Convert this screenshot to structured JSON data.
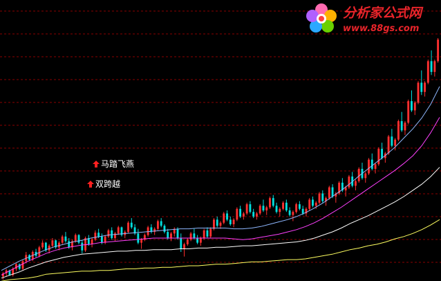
{
  "watermark": {
    "title": "分析家公式网",
    "url": "www.88gs.com"
  },
  "signals": [
    {
      "label": "马踏飞燕",
      "marker": "up-arrow-icon"
    },
    {
      "label": "双跨越",
      "marker": "up-arrow-icon"
    }
  ],
  "colors": {
    "background": "#000000",
    "grid": "#8b0000",
    "up_candle": "#ff3030",
    "down_candle": "#00e0e0",
    "ma_fast": "#ffff60",
    "ma_mid": "#ffffff",
    "ma_slow": "#ff40ff",
    "ma_long": "#8fb8ff",
    "signal_arrow": "#ff2020"
  },
  "chart_data": {
    "type": "candlestick",
    "grid": true,
    "series": [
      {
        "values": [
          2,
          4,
          5,
          6,
          8,
          11,
          12,
          13,
          14,
          15,
          15,
          16,
          16,
          17,
          18,
          18,
          19,
          19,
          20,
          20,
          21,
          22,
          22,
          23,
          24,
          24,
          25,
          26,
          27,
          27,
          28,
          29,
          30,
          30,
          31,
          33,
          35,
          37,
          40,
          43,
          45,
          48,
          50,
          53,
          57,
          60,
          64,
          69,
          75,
          82
        ]
      },
      {
        "values": [
          6,
          10,
          14,
          19,
          23,
          27,
          30,
          33,
          35,
          37,
          38,
          39,
          40,
          41,
          41,
          42,
          42,
          43,
          43,
          43,
          44,
          44,
          45,
          45,
          46,
          46,
          47,
          48,
          48,
          49,
          50,
          51,
          52,
          53,
          55,
          58,
          62,
          66,
          71,
          77,
          82,
          87,
          93,
          99,
          105,
          112,
          120,
          128,
          138,
          150
        ]
      },
      {
        "values": [
          10,
          16,
          22,
          28,
          33,
          38,
          42,
          45,
          47,
          49,
          50,
          52,
          53,
          54,
          55,
          56,
          57,
          58,
          58,
          58,
          58,
          58,
          58,
          58,
          58,
          58,
          57,
          56,
          57,
          59,
          61,
          63,
          66,
          69,
          73,
          78,
          84,
          91,
          98,
          106,
          114,
          122,
          130,
          138,
          146,
          155,
          165,
          178,
          195,
          215
        ]
      },
      {
        "values": [
          16,
          22,
          28,
          33,
          38,
          43,
          47,
          50,
          53,
          55,
          58,
          60,
          62,
          63,
          64,
          65,
          66,
          67,
          68,
          69,
          70,
          70,
          71,
          71,
          71,
          71,
          70,
          70,
          71,
          73,
          76,
          79,
          82,
          86,
          91,
          97,
          104,
          112,
          120,
          129,
          139,
          148,
          157,
          166,
          176,
          188,
          200,
          214,
          232,
          255
        ]
      }
    ],
    "candles": [
      [
        8,
        14,
        4,
        12
      ],
      [
        12,
        18,
        8,
        16
      ],
      [
        16,
        17,
        9,
        10
      ],
      [
        10,
        20,
        8,
        18
      ],
      [
        18,
        26,
        15,
        24
      ],
      [
        24,
        25,
        16,
        18
      ],
      [
        18,
        30,
        16,
        28
      ],
      [
        28,
        40,
        25,
        36
      ],
      [
        36,
        37,
        28,
        30
      ],
      [
        30,
        42,
        28,
        40
      ],
      [
        40,
        44,
        33,
        35
      ],
      [
        35,
        48,
        33,
        46
      ],
      [
        46,
        55,
        44,
        52
      ],
      [
        52,
        53,
        40,
        42
      ],
      [
        42,
        50,
        38,
        48
      ],
      [
        48,
        58,
        45,
        55
      ],
      [
        55,
        56,
        44,
        46
      ],
      [
        46,
        54,
        42,
        52
      ],
      [
        52,
        62,
        50,
        60
      ],
      [
        60,
        66,
        52,
        54
      ],
      [
        54,
        58,
        44,
        46
      ],
      [
        46,
        56,
        42,
        54
      ],
      [
        54,
        64,
        52,
        62
      ],
      [
        62,
        63,
        50,
        52
      ],
      [
        52,
        56,
        38,
        42
      ],
      [
        42,
        60,
        40,
        58
      ],
      [
        58,
        62,
        48,
        50
      ],
      [
        50,
        58,
        46,
        56
      ],
      [
        56,
        68,
        54,
        65
      ],
      [
        65,
        70,
        58,
        60
      ],
      [
        60,
        64,
        50,
        52
      ],
      [
        52,
        62,
        50,
        60
      ],
      [
        60,
        70,
        58,
        68
      ],
      [
        68,
        72,
        56,
        58
      ],
      [
        58,
        66,
        54,
        64
      ],
      [
        64,
        74,
        62,
        72
      ],
      [
        72,
        73,
        60,
        62
      ],
      [
        62,
        68,
        58,
        66
      ],
      [
        66,
        80,
        64,
        78
      ],
      [
        78,
        84,
        70,
        72
      ],
      [
        72,
        76,
        62,
        64
      ],
      [
        64,
        70,
        50,
        52
      ],
      [
        52,
        58,
        44,
        56
      ],
      [
        56,
        64,
        54,
        62
      ],
      [
        62,
        74,
        60,
        72
      ],
      [
        72,
        76,
        64,
        66
      ],
      [
        66,
        72,
        62,
        70
      ],
      [
        70,
        82,
        68,
        80
      ],
      [
        80,
        84,
        72,
        74
      ],
      [
        74,
        76,
        64,
        66
      ],
      [
        66,
        70,
        56,
        58
      ],
      [
        58,
        66,
        54,
        64
      ],
      [
        64,
        72,
        60,
        70
      ],
      [
        70,
        72,
        56,
        58
      ],
      [
        58,
        64,
        40,
        44
      ],
      [
        44,
        52,
        34,
        50
      ],
      [
        50,
        58,
        48,
        56
      ],
      [
        56,
        66,
        54,
        64
      ],
      [
        64,
        70,
        56,
        58
      ],
      [
        58,
        62,
        50,
        52
      ],
      [
        52,
        60,
        48,
        58
      ],
      [
        58,
        70,
        56,
        68
      ],
      [
        68,
        72,
        58,
        60
      ],
      [
        60,
        72,
        58,
        70
      ],
      [
        70,
        84,
        68,
        82
      ],
      [
        82,
        86,
        72,
        74
      ],
      [
        74,
        80,
        70,
        78
      ],
      [
        78,
        92,
        76,
        90
      ],
      [
        90,
        94,
        80,
        82
      ],
      [
        82,
        86,
        74,
        76
      ],
      [
        76,
        84,
        72,
        82
      ],
      [
        82,
        98,
        80,
        96
      ],
      [
        96,
        100,
        84,
        86
      ],
      [
        86,
        92,
        82,
        90
      ],
      [
        90,
        104,
        88,
        102
      ],
      [
        102,
        106,
        90,
        92
      ],
      [
        92,
        96,
        84,
        86
      ],
      [
        86,
        92,
        82,
        90
      ],
      [
        90,
        102,
        88,
        100
      ],
      [
        100,
        108,
        92,
        94
      ],
      [
        94,
        100,
        88,
        98
      ],
      [
        98,
        112,
        96,
        110
      ],
      [
        110,
        114,
        98,
        100
      ],
      [
        100,
        104,
        90,
        92
      ],
      [
        92,
        98,
        86,
        96
      ],
      [
        96,
        106,
        94,
        104
      ],
      [
        104,
        108,
        92,
        94
      ],
      [
        94,
        98,
        86,
        88
      ],
      [
        88,
        94,
        80,
        92
      ],
      [
        92,
        104,
        90,
        102
      ],
      [
        102,
        106,
        94,
        96
      ],
      [
        96,
        100,
        88,
        90
      ],
      [
        90,
        98,
        86,
        96
      ],
      [
        96,
        110,
        94,
        108
      ],
      [
        108,
        112,
        98,
        100
      ],
      [
        100,
        106,
        96,
        104
      ],
      [
        104,
        118,
        102,
        116
      ],
      [
        116,
        120,
        104,
        106
      ],
      [
        106,
        112,
        100,
        110
      ],
      [
        110,
        126,
        108,
        124
      ],
      [
        124,
        128,
        110,
        112
      ],
      [
        112,
        118,
        104,
        116
      ],
      [
        116,
        132,
        114,
        130
      ],
      [
        130,
        136,
        118,
        120
      ],
      [
        120,
        126,
        112,
        124
      ],
      [
        124,
        140,
        122,
        138
      ],
      [
        138,
        144,
        124,
        126
      ],
      [
        126,
        134,
        120,
        132
      ],
      [
        132,
        150,
        130,
        148
      ],
      [
        148,
        156,
        134,
        136
      ],
      [
        136,
        144,
        130,
        142
      ],
      [
        142,
        162,
        140,
        160
      ],
      [
        160,
        168,
        146,
        148
      ],
      [
        148,
        156,
        142,
        154
      ],
      [
        154,
        176,
        152,
        174
      ],
      [
        174,
        182,
        160,
        162
      ],
      [
        162,
        170,
        156,
        168
      ],
      [
        168,
        192,
        166,
        190
      ],
      [
        190,
        200,
        176,
        178
      ],
      [
        178,
        188,
        172,
        186
      ],
      [
        186,
        212,
        184,
        210
      ],
      [
        210,
        222,
        196,
        198
      ],
      [
        198,
        210,
        192,
        208
      ],
      [
        208,
        238,
        206,
        236
      ],
      [
        236,
        250,
        222,
        224
      ],
      [
        224,
        236,
        218,
        234
      ],
      [
        234,
        262,
        232,
        260
      ],
      [
        260,
        276,
        244,
        248
      ],
      [
        248,
        262,
        242,
        260
      ],
      [
        260,
        290,
        258,
        288
      ],
      [
        288,
        302,
        270,
        274
      ],
      [
        274,
        290,
        268,
        288
      ],
      [
        288,
        318,
        286,
        316
      ]
    ]
  }
}
